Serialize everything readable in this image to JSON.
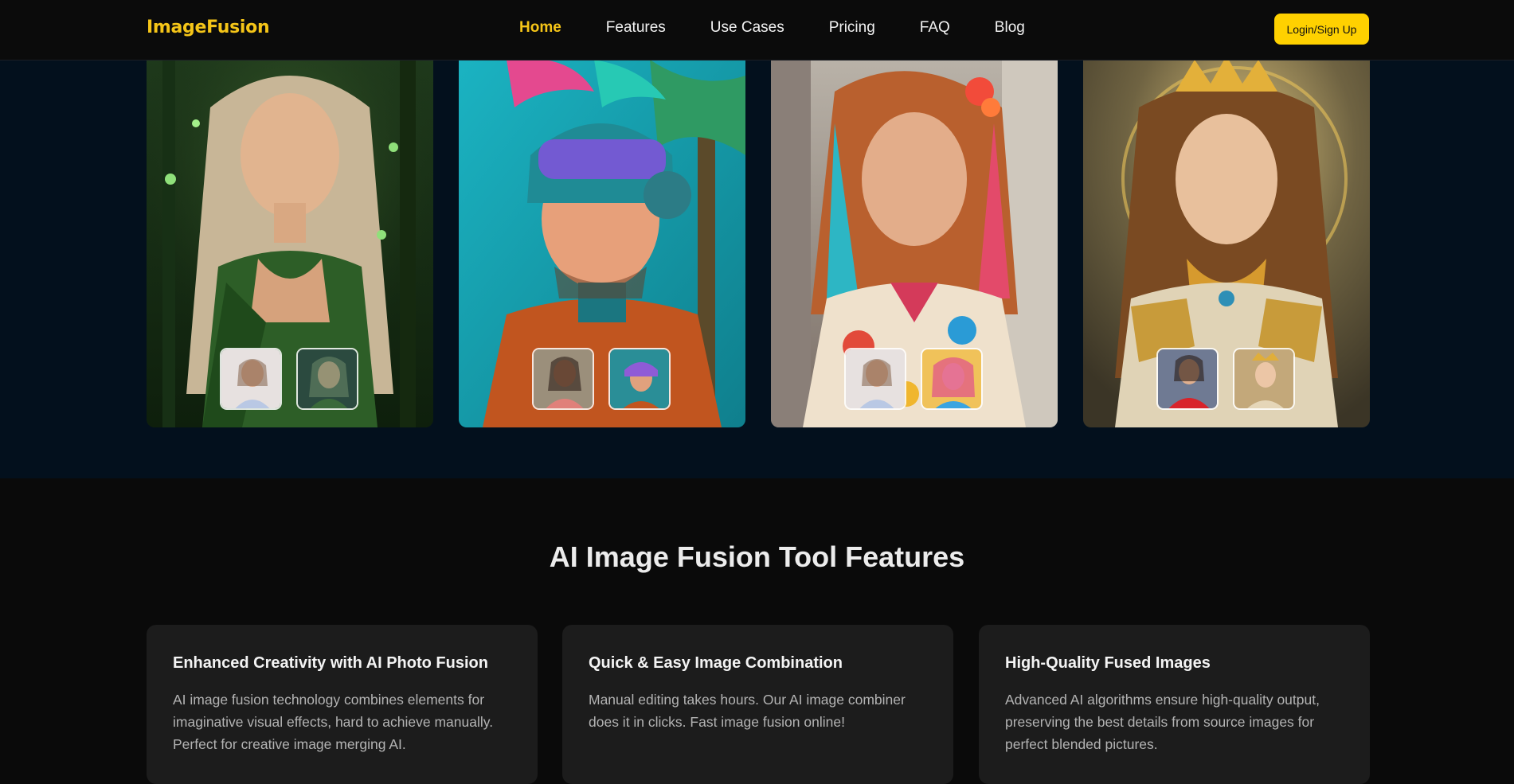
{
  "nav": {
    "logo": "ImageFusion",
    "links": [
      {
        "label": "Home",
        "active": true
      },
      {
        "label": "Features",
        "active": false
      },
      {
        "label": "Use Cases",
        "active": false
      },
      {
        "label": "Pricing",
        "active": false
      },
      {
        "label": "FAQ",
        "active": false
      },
      {
        "label": "Blog",
        "active": false
      }
    ],
    "login_label": "Login/Sign Up"
  },
  "gallery": {
    "cards": [
      {
        "name": "forest-fairy",
        "icon": "portrait-image"
      },
      {
        "name": "futuristic-helmet-girl",
        "icon": "portrait-image"
      },
      {
        "name": "colorful-hair-girl",
        "icon": "portrait-image"
      },
      {
        "name": "golden-goddess",
        "icon": "portrait-image"
      }
    ]
  },
  "features": {
    "title": "AI Image Fusion Tool Features",
    "cards": [
      {
        "title": "Enhanced Creativity with AI Photo Fusion",
        "description": "AI image fusion technology combines elements for imaginative visual effects, hard to achieve manually. Perfect for creative image merging AI."
      },
      {
        "title": "Quick & Easy Image Combination",
        "description": "Manual editing takes hours. Our AI image combiner does it in clicks. Fast image fusion online!"
      },
      {
        "title": "High-Quality Fused Images",
        "description": "Advanced AI algorithms ensure high-quality output, preserving the best details from source images for perfect blended pictures."
      }
    ]
  },
  "colors": {
    "accent": "#f5c518",
    "button": "#ffd100",
    "gallery_bg": "#03101d",
    "card_bg": "#1c1c1c"
  }
}
